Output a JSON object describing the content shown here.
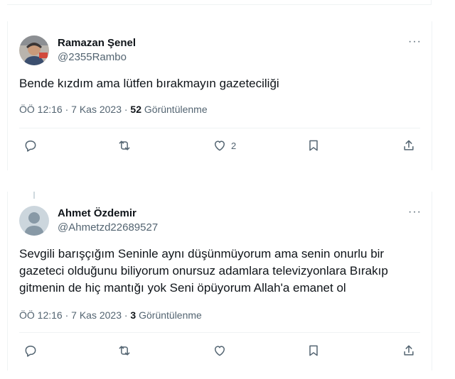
{
  "tweets": [
    {
      "name": "Ramazan Şenel",
      "handle": "@2355Rambo",
      "text": "Bende kızdım ama lütfen bırakmayın gazeteciliği",
      "time": "ÖÖ 12:16 · 7 Kas 2023 · ",
      "views_count": "52",
      "views_label": " Görüntülenme",
      "like_count": "2"
    },
    {
      "name": "Ahmet Özdemir",
      "handle": "@Ahmetzd22689527",
      "text": "Sevgili barışçığım Seninle aynı düşünmüyorum ama senin onurlu bir gazeteci olduğunu biliyorum onursuz adamlara televizyonlara Bırakıp gitmenin de hiç mantığı yok Seni öpüyorum Allah'a emanet ol",
      "time": "ÖÖ 12:16 · 7 Kas 2023 · ",
      "views_count": "3",
      "views_label": " Görüntülenme",
      "like_count": ""
    }
  ],
  "more_label": "···",
  "icons": [
    "reply-icon",
    "retweet-icon",
    "like-icon",
    "bookmark-icon",
    "share-icon",
    "more-icon"
  ]
}
